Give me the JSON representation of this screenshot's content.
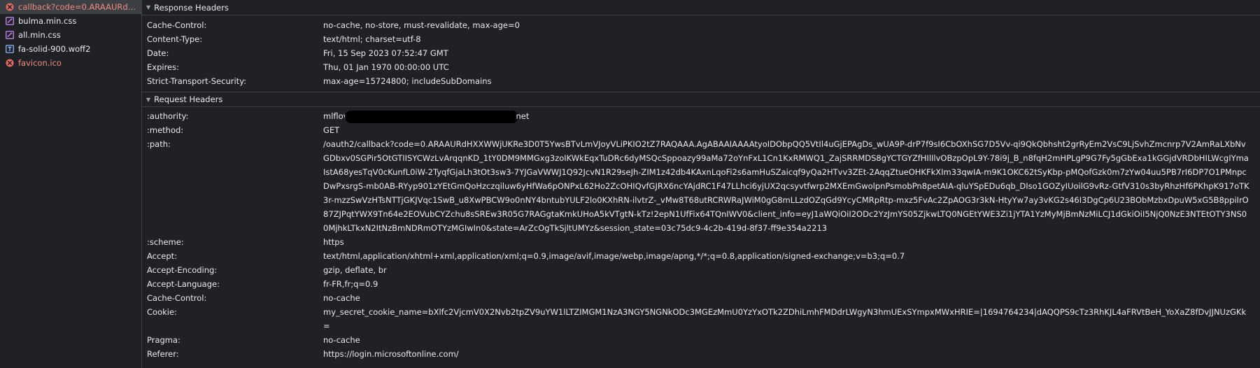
{
  "files": [
    {
      "name": "callback?code=0.ARAAURdHX...",
      "status": "error",
      "icon": "error-circle-icon",
      "selected": true
    },
    {
      "name": "bulma.min.css",
      "status": "normal",
      "icon": "css-file-icon"
    },
    {
      "name": "all.min.css",
      "status": "normal",
      "icon": "css-file-icon"
    },
    {
      "name": "fa-solid-900.woff2",
      "status": "normal",
      "icon": "font-file-icon"
    },
    {
      "name": "favicon.ico",
      "status": "error",
      "icon": "error-circle-icon"
    }
  ],
  "response_headers": {
    "title": "Response Headers",
    "rows": [
      {
        "k": "Cache-Control:",
        "v": "no-cache, no-store, must-revalidate, max-age=0"
      },
      {
        "k": "Content-Type:",
        "v": "text/html; charset=utf-8"
      },
      {
        "k": "Date:",
        "v": "Fri, 15 Sep 2023 07:52:47 GMT"
      },
      {
        "k": "Expires:",
        "v": "Thu, 01 Jan 1970 00:00:00 UTC"
      },
      {
        "k": "Strict-Transport-Security:",
        "v": "max-age=15724800; includeSubDomains"
      }
    ]
  },
  "request_headers": {
    "title": "Request Headers",
    "authority_key": ":authority:",
    "authority_prefix": "mlflov",
    "authority_suffix": "net",
    "rows": [
      {
        "k": ":method:",
        "v": "GET"
      },
      {
        "k": ":path:",
        "v": "/oauth2/callback?code=0.ARAAURdHXXWWjUKRe3D0T5YwsBTvLmVJoyVLiPKIO2tZ7RAQAAA.AgABAAIAAAAtyoIDObpQQ5VtIl4uGjEPAgDs_wUA9P-drP7f9sI6CbOXhSG7D5Vv-qi9QkQbhsht2grRyEm2VsC9LjSvhZmcnrp7V2AmRaLXbNvGDbxv0SGPir5OtGTIISYCWzLvArqqnKD_1tY0DM9MMGxg3zoIKWkEqxTuDRc6dyMSQcSppoazy99aMa72oYnFxL1Cn1KxRMWQ1_ZajSRRMDS8gYCTGYZfHIlIlvOBzpOpL9Y-78i9j_B_n8fqH2mHPLgP9G7Fy5gGbExa1kGGjdVRDbHILWcgIYmaIstA68yesTqV0cKunfL0iW-2TyqfGjaLh3tOt3sw3-7YJGaVWWJ1Q92JcvN1R29seJh-ZIM1z42db4KAxnLqoFi2s6amHuSZaicqf9yQa2HTvv3ZEt-2AqqZtueOHKFkXIm33qwIA-m9K1OKC62tSyKbp-pMQofGzk0m7zYw04uu5PB7rI6DP7O1PMnpcDwPxsrgS-mb0AB-RYyp901zYEtGmQoHzczqiluw6yHfWa6pONPxL62Ho2ZcOHIQvfGJRX6ncYAjdRC1F47LLhci6yjUX2qcsyvtfwrp2MXEmGwolpnPsmobPn8petAIA-qluYSpEDu6qb_DIso1GOZyIUoilG9vRz-GtfV310s3byRhzHf6PKhpK917oTK3r-mzzSwVzHTsNTTjGKJVqc1SwB_u8XwPBCW9o0nNY4bntubYULF2lo0KXhRN-ilvtrZ-_vMw8T68utRCRWRaJWiM0gG8mLLzdOZqGd9YcyCMRpRtp-mxz5FvAc2ZpAOG3r3kN-HtyYw7ay3vKG2s46I3DgCp6U23BObMzbxDpuW5xG5B8ppiIrO87ZJPqtYWX9Tn64e2EOVubCYZchu8sSREw3R05G7RAGgtaKmkUHoA5kVTgtN-kTz!2epN1UfFix64TQnIWV0&client_info=eyJ1aWQiOiI2ODc2YzJmYS05ZjkwLTQ0NGEtYWE3Zi1jYTA1YzMyMjBmNzMiLCJ1dGkiOiI5NjQ0NzE3NTEtOTY3NS00MjhkLTkxN2ItNzBmNDRmOTYzMGIwIn0&state=ArZcOgTkSjltUMYz&session_state=03c75dc9-4c2b-419d-8f37-ff9e354a2213"
      },
      {
        "k": ":scheme:",
        "v": "https"
      },
      {
        "k": "Accept:",
        "v": "text/html,application/xhtml+xml,application/xml;q=0.9,image/avif,image/webp,image/apng,*/*;q=0.8,application/signed-exchange;v=b3;q=0.7"
      },
      {
        "k": "Accept-Encoding:",
        "v": "gzip, deflate, br"
      },
      {
        "k": "Accept-Language:",
        "v": "fr-FR,fr;q=0.9"
      },
      {
        "k": "Cache-Control:",
        "v": "no-cache"
      },
      {
        "k": "Cookie:",
        "v": "my_secret_cookie_name=bXlfc2VjcmV0X2Nvb2tpZV9uYW1lLTZIMGM1NzA3NGY5NGNkODc3MGEzMmU0YzYxOTk2ZDhiLmhFMDdrLWgyN3hmUExSYmpxMWxHRIE=|1694764234|dAQQPS9cTz3RhKJL4aFRVtBeH_YoXaZ8fDvJJNUzGKk="
      },
      {
        "k": "Pragma:",
        "v": "no-cache"
      },
      {
        "k": "Referer:",
        "v": "https://login.microsoftonline.com/"
      }
    ]
  },
  "colors": {
    "error": "#f28b82",
    "css_icon": "#c58af9",
    "font_icon": "#8ab4f8",
    "background": "#202124"
  }
}
